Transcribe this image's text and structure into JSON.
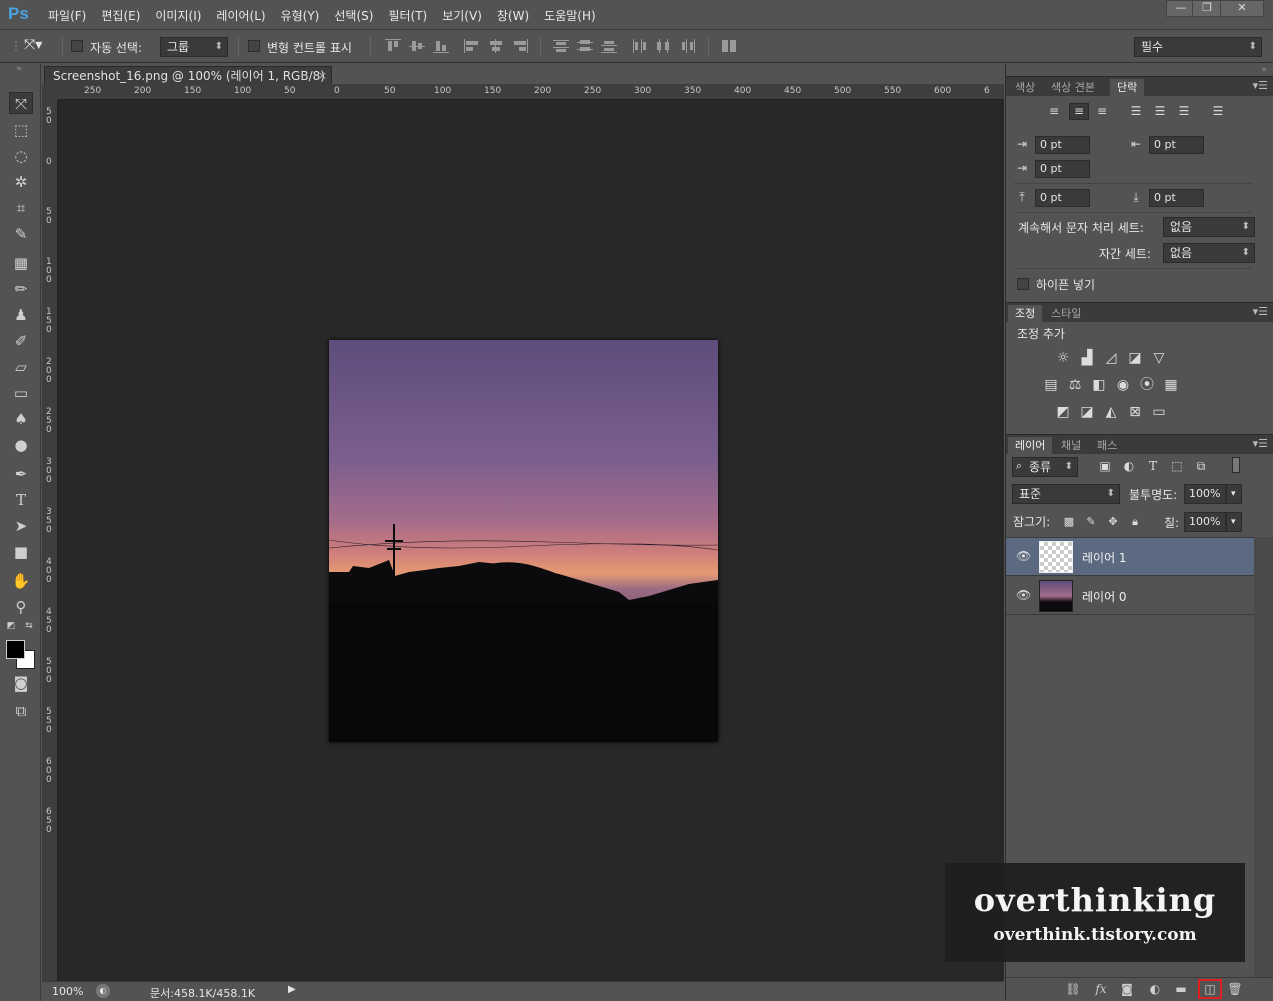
{
  "app": {
    "logo": "Ps"
  },
  "menu": [
    "파일(F)",
    "편집(E)",
    "이미지(I)",
    "레이어(L)",
    "유형(Y)",
    "선택(S)",
    "필터(T)",
    "보기(V)",
    "창(W)",
    "도움말(H)"
  ],
  "window_controls": {
    "minimize": "—",
    "restore": "❐",
    "close": "✕"
  },
  "options": {
    "auto_select_label": "자동 선택:",
    "auto_select_value": "그룹",
    "transform_label": "변형 컨트롤 표시",
    "workspace": "필수"
  },
  "document": {
    "tab_title": "Screenshot_16.png @ 100% (레이어 1, RGB/8) *",
    "close": "×",
    "ruler_h": [
      "250",
      "200",
      "150",
      "100",
      "50",
      "0",
      "50",
      "100",
      "150",
      "200",
      "250",
      "300",
      "350",
      "400",
      "450",
      "500",
      "550",
      "600",
      "6"
    ],
    "ruler_v": [
      "5\n0",
      "0",
      "5\n0",
      "1\n0\n0",
      "1\n5\n0",
      "2\n0\n0",
      "2\n5\n0",
      "3\n0\n0",
      "3\n5\n0",
      "4\n0\n0",
      "4\n5\n0",
      "5\n0\n0",
      "5\n5\n0",
      "6\n0\n0",
      "6\n5\n0"
    ]
  },
  "status": {
    "zoom": "100%",
    "doc": "문서:458.1K/458.1K"
  },
  "panels": {
    "char_tabs": [
      "색상",
      "색상 견본",
      "단락"
    ],
    "paragraph": {
      "indent_left": "0 pt",
      "indent_right": "0 pt",
      "indent_first": "0 pt",
      "space_before": "0 pt",
      "space_after": "0 pt",
      "kinsoku_label": "계속해서 문자 처리 세트:",
      "kinsoku_value": "없음",
      "mojikumi_label": "자간 세트:",
      "mojikumi_value": "없음",
      "hyphenate_label": "하이픈 넣기"
    },
    "adj_tabs": [
      "조정",
      "스타일"
    ],
    "adjust_add": "조정 추가",
    "layer_tabs": [
      "레이어",
      "채널",
      "패스"
    ],
    "layers": {
      "filter": "종류",
      "blend_mode": "표준",
      "opacity_label": "불투명도:",
      "opacity": "100%",
      "lock_label": "잠그기:",
      "fill_label": "칠:",
      "fill": "100%",
      "items": [
        {
          "name": "레이어 1",
          "selected": true
        },
        {
          "name": "레이어 0",
          "selected": false
        }
      ]
    }
  },
  "watermark": {
    "title": "overthinking",
    "url": "overthink.tistory.com"
  },
  "colors": {
    "highlight_box": "#e02020",
    "selected_layer": "#5b6a80"
  }
}
